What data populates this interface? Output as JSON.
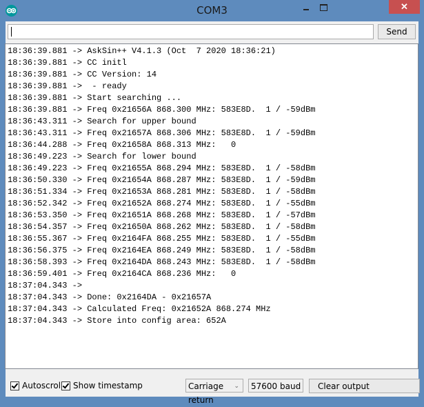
{
  "window": {
    "title": "COM3",
    "app_icon": "arduino-logo-icon",
    "controls": {
      "minimize": "minimize-icon",
      "maximize": "maximize-icon",
      "close": "✕"
    }
  },
  "send_bar": {
    "input_value": "",
    "send_label": "Send"
  },
  "output": {
    "lines": [
      "18:36:39.881 -> AskSin++ V4.1.3 (Oct  7 2020 18:36:21)",
      "18:36:39.881 -> CC initl",
      "18:36:39.881 -> CC Version: 14",
      "18:36:39.881 ->  - ready",
      "18:36:39.881 -> Start searching ...",
      "18:36:39.881 -> Freq 0x21656A 868.300 MHz: 583E8D.  1 / -59dBm",
      "18:36:43.311 -> Search for upper bound",
      "18:36:43.311 -> Freq 0x21657A 868.306 MHz: 583E8D.  1 / -59dBm",
      "18:36:44.288 -> Freq 0x21658A 868.313 MHz:   0",
      "18:36:49.223 -> Search for lower bound",
      "18:36:49.223 -> Freq 0x21655A 868.294 MHz: 583E8D.  1 / -58dBm",
      "18:36:50.330 -> Freq 0x21654A 868.287 MHz: 583E8D.  1 / -59dBm",
      "18:36:51.334 -> Freq 0x21653A 868.281 MHz: 583E8D.  1 / -58dBm",
      "18:36:52.342 -> Freq 0x21652A 868.274 MHz: 583E8D.  1 / -55dBm",
      "18:36:53.350 -> Freq 0x21651A 868.268 MHz: 583E8D.  1 / -57dBm",
      "18:36:54.357 -> Freq 0x21650A 868.262 MHz: 583E8D.  1 / -58dBm",
      "18:36:55.367 -> Freq 0x2164FA 868.255 MHz: 583E8D.  1 / -55dBm",
      "18:36:56.375 -> Freq 0x2164EA 868.249 MHz: 583E8D.  1 / -58dBm",
      "18:36:58.393 -> Freq 0x2164DA 868.243 MHz: 583E8D.  1 / -58dBm",
      "18:36:59.401 -> Freq 0x2164CA 868.236 MHz:   0",
      "18:37:04.343 -> ",
      "18:37:04.343 -> Done: 0x2164DA - 0x21657A",
      "18:37:04.343 -> Calculated Freq: 0x21652A 868.274 MHz",
      "18:37:04.343 -> Store into config area: 652A"
    ]
  },
  "footer": {
    "autoscroll": {
      "label": "Autoscroll",
      "checked": true
    },
    "show_timestamp": {
      "label": "Show timestamp",
      "checked": true
    },
    "line_ending": {
      "selected": "Carriage return"
    },
    "baud_rate": {
      "selected": "57600 baud"
    },
    "clear_label": "Clear output"
  }
}
